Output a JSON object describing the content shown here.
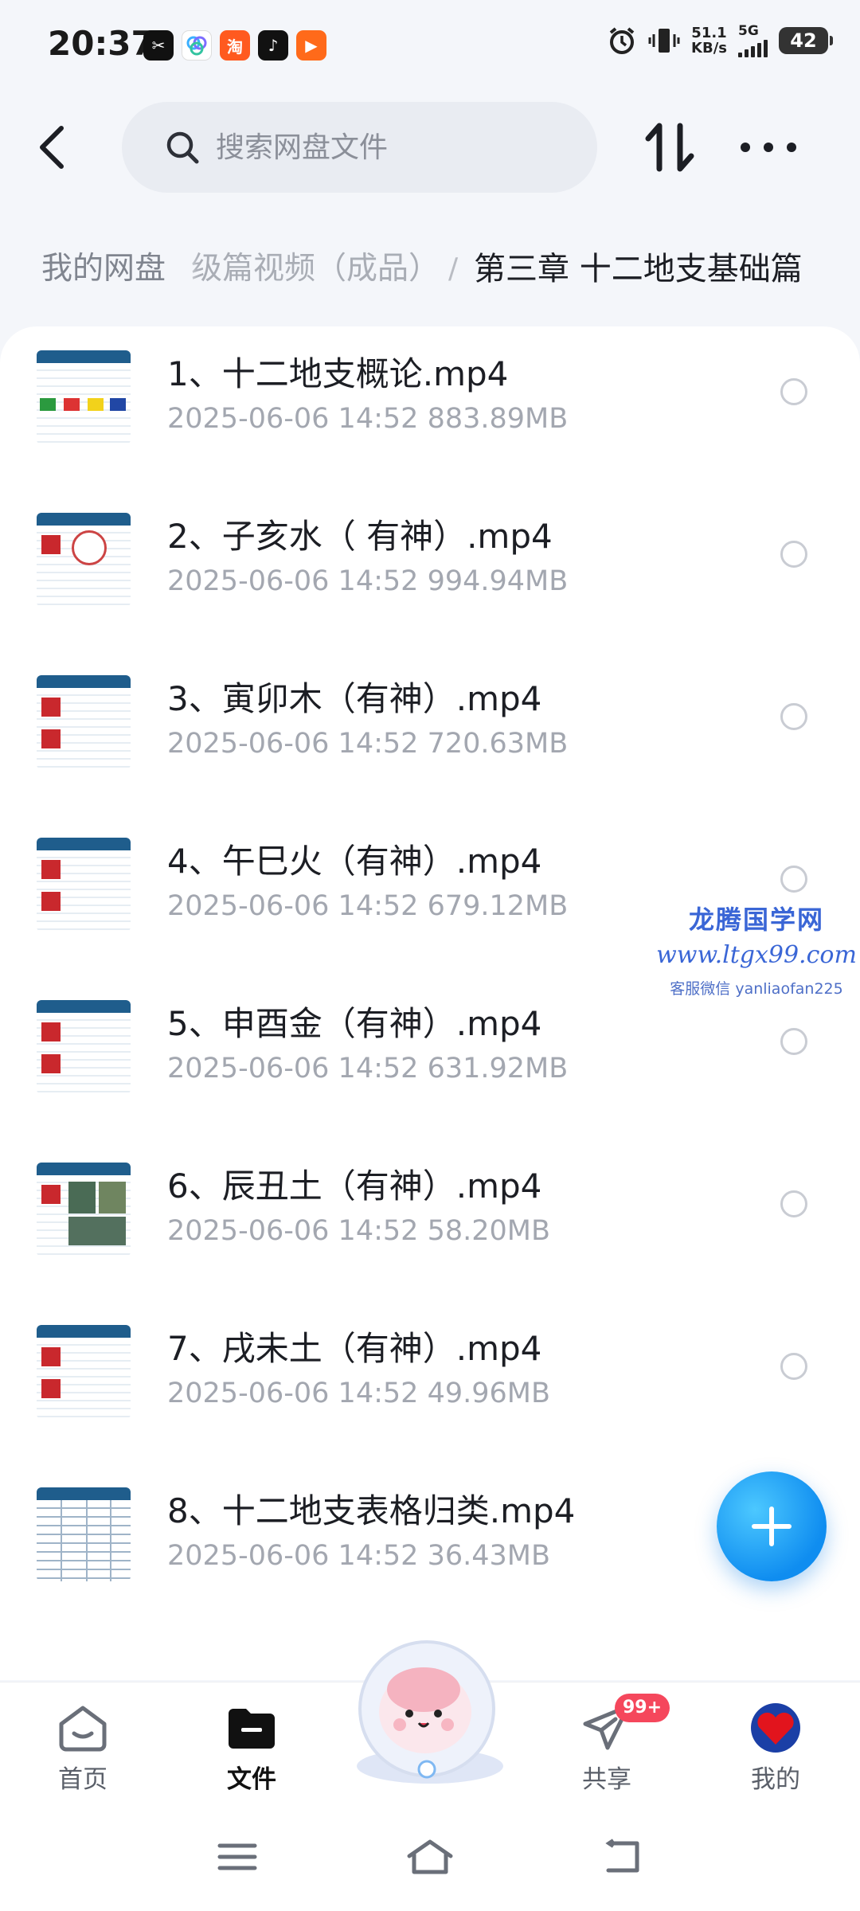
{
  "status_bar": {
    "time": "20:37",
    "net_speed_value": "51.1",
    "net_speed_unit": "KB/s",
    "network_type": "5G",
    "battery": "42",
    "notification_icons": [
      "capcut-icon",
      "baidu-netdisk-icon",
      "taobao-icon",
      "tiktok-icon",
      "kuaishou-icon"
    ],
    "right_icons": [
      "alarm-icon",
      "vibrate-icon",
      "signal-icon",
      "battery-icon"
    ]
  },
  "header": {
    "search_placeholder": "搜索网盘文件",
    "icons": [
      "back-icon",
      "search-icon",
      "sort-icon",
      "more-icon"
    ]
  },
  "breadcrumb": {
    "root": "我的网盘",
    "middle": "级篇视频（成品）",
    "separator": "/",
    "current": "第三章 十二地支基础篇"
  },
  "files": [
    {
      "name": "1、十二地支概论.mp4",
      "date": "2025-06-06",
      "time": "14:52",
      "size": "883.89MB"
    },
    {
      "name": "2、子亥水（ 有神）.mp4",
      "date": "2025-06-06",
      "time": "14:52",
      "size": "994.94MB"
    },
    {
      "name": "3、寅卯木（有神）.mp4",
      "date": "2025-06-06",
      "time": "14:52",
      "size": "720.63MB"
    },
    {
      "name": "4、午巳火（有神）.mp4",
      "date": "2025-06-06",
      "time": "14:52",
      "size": "679.12MB"
    },
    {
      "name": "5、申酉金（有神）.mp4",
      "date": "2025-06-06",
      "time": "14:52",
      "size": "631.92MB"
    },
    {
      "name": "6、辰丑土（有神）.mp4",
      "date": "2025-06-06",
      "time": "14:52",
      "size": "58.20MB"
    },
    {
      "name": "7、戌未土（有神）.mp4",
      "date": "2025-06-06",
      "time": "14:52",
      "size": "49.96MB"
    },
    {
      "name": "8、十二地支表格归类.mp4",
      "date": "2025-06-06",
      "time": "14:52",
      "size": "36.43MB"
    }
  ],
  "watermark": {
    "title": "龙腾国学网",
    "url": "www.ltgx99.com",
    "contact": "客服微信 yanliaofan225"
  },
  "bottom_nav": {
    "items": [
      {
        "label": "首页",
        "icon": "home-icon",
        "active": false
      },
      {
        "label": "文件",
        "icon": "folder-icon",
        "active": true
      },
      {
        "label": "共享",
        "icon": "share-icon",
        "active": false,
        "badge": "99+"
      },
      {
        "label": "我的",
        "icon": "profile-avatar-icon",
        "active": false
      }
    ]
  },
  "system_nav": [
    "menu-icon",
    "home-button-icon",
    "back-button-icon"
  ],
  "colors": {
    "accent": "#1f8ef0",
    "badge": "#f5475c",
    "watermark": "#3a66d6"
  }
}
